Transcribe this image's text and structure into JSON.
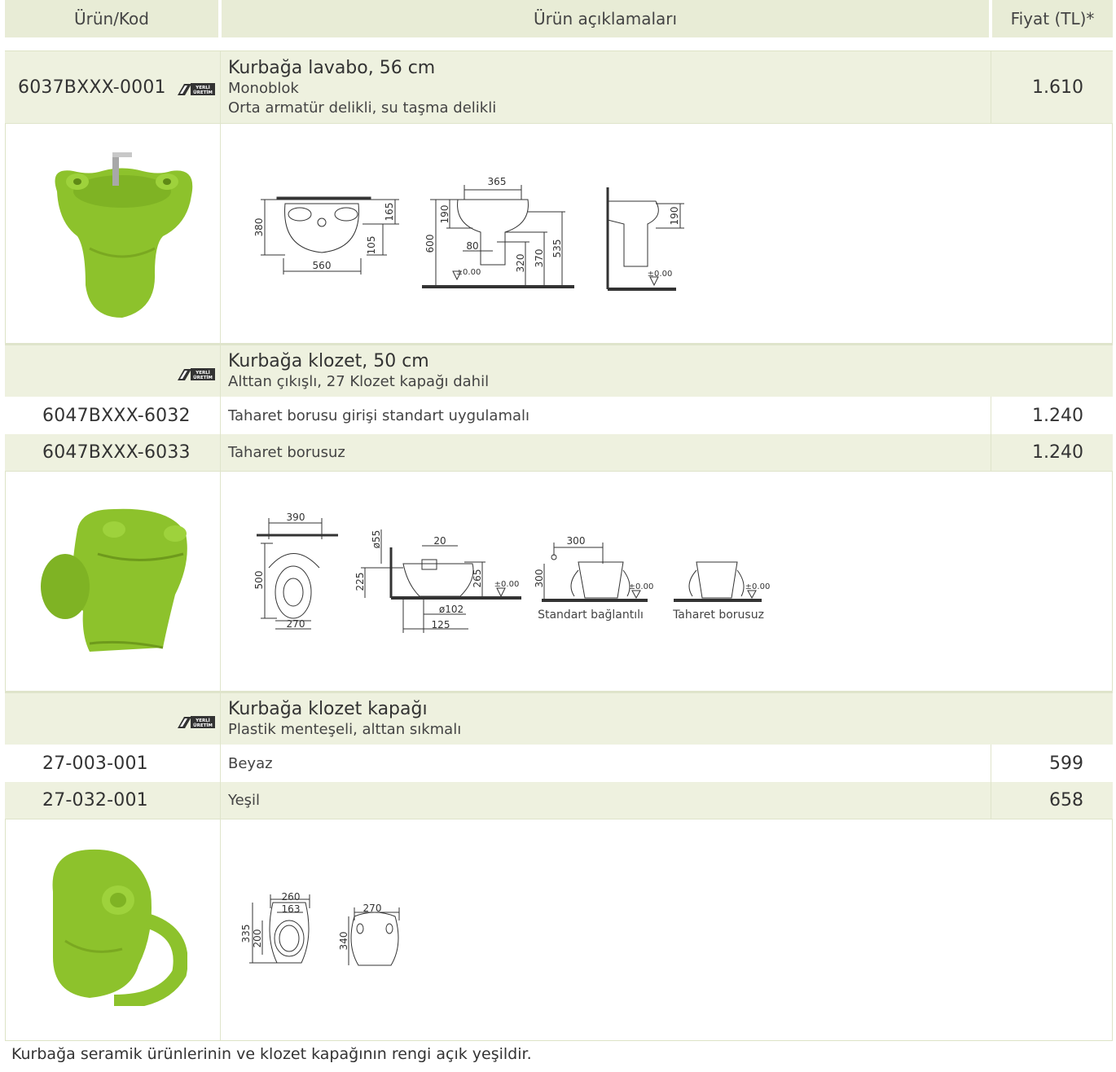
{
  "header": {
    "col_code": "Ürün/Kod",
    "col_desc": "Ürün açıklamaları",
    "col_price": "Fiyat (TL)*"
  },
  "badge": {
    "line1": "YERLİ",
    "line2": "ÜRETİM"
  },
  "colors": {
    "header_bg": "#e8ecd6",
    "row_shade": "#eef1df",
    "frog_green": "#8dc22c"
  },
  "products": [
    {
      "code": "6037BXXX-0001",
      "title": "Kurbağa lavabo, 56 cm",
      "lines": [
        "Monoblok",
        "Orta armatür delikli, su taşma delikli"
      ],
      "price": "1.610",
      "dims": {
        "d380": "380",
        "d560": "560",
        "d165": "165",
        "d105": "105",
        "d365": "365",
        "d190a": "190",
        "d600": "600",
        "d80": "80",
        "d320": "320",
        "d370": "370",
        "d535": "535",
        "d000a": "±0.00",
        "d190b": "190",
        "d000b": "±0.00"
      }
    },
    {
      "title": "Kurbağa klozet, 50 cm",
      "lines": [
        "Alttan çıkışlı, 27 Klozet kapağı dahil"
      ],
      "variants": [
        {
          "code": "6047BXXX-6032",
          "desc": "Taharet borusu girişi standart uygulamalı",
          "price": "1.240"
        },
        {
          "code": "6047BXXX-6033",
          "desc": "Taharet borusuz",
          "price": "1.240"
        }
      ],
      "dims": {
        "d390": "390",
        "d500": "500",
        "d270": "270",
        "d55": "ø55",
        "d20": "20",
        "d225": "225",
        "d265": "265",
        "d000a": "±0.00",
        "d102": "ø102",
        "d125": "125",
        "d300a": "300",
        "d300b": "300",
        "d000b": "±0.00",
        "d000c": "±0.00",
        "cap1": "Standart bağlantılı",
        "cap2": "Taharet borusuz"
      }
    },
    {
      "title": "Kurbağa klozet kapağı",
      "lines": [
        "Plastik menteşeli, alttan sıkmalı"
      ],
      "variants": [
        {
          "code": "27-003-001",
          "desc": "Beyaz",
          "price": "599"
        },
        {
          "code": "27-032-001",
          "desc": "Yeşil",
          "price": "658"
        }
      ],
      "dims": {
        "d260": "260",
        "d163": "163",
        "d335": "335",
        "d200": "200",
        "d270": "270",
        "d340": "340"
      }
    }
  ],
  "footnote": "Kurbağa seramik ürünlerinin ve klozet kapağının rengi açık yeşildir."
}
